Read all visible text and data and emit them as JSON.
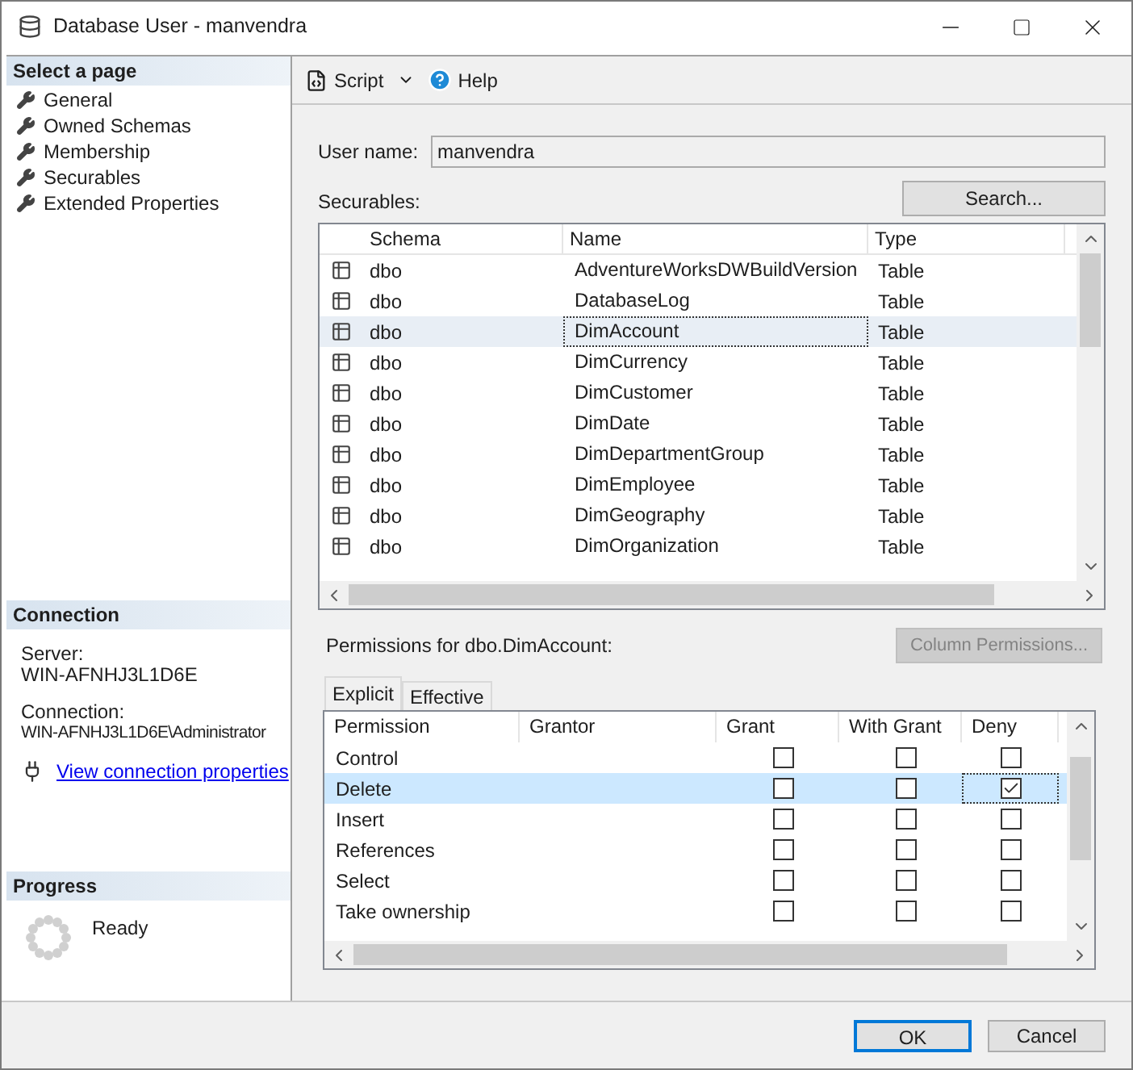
{
  "window": {
    "title": "Database User - manvendra"
  },
  "sidebar": {
    "header": "Select a page",
    "items": [
      {
        "label": "General"
      },
      {
        "label": "Owned Schemas"
      },
      {
        "label": "Membership"
      },
      {
        "label": "Securables"
      },
      {
        "label": "Extended Properties"
      }
    ]
  },
  "connection": {
    "header": "Connection",
    "server_label": "Server:",
    "server": "WIN-AFNHJ3L1D6E",
    "connection_label": "Connection:",
    "connection": "WIN-AFNHJ3L1D6E\\Administrator",
    "link": "View connection properties"
  },
  "progress": {
    "header": "Progress",
    "status": "Ready"
  },
  "toolbar": {
    "script": "Script",
    "help": "Help"
  },
  "user_name": {
    "label": "User name:",
    "value": "manvendra"
  },
  "securables": {
    "label": "Securables:",
    "search": "Search...",
    "columns": [
      "Schema",
      "Name",
      "Type"
    ],
    "rows": [
      {
        "schema": "dbo",
        "name": "AdventureWorksDWBuildVersion",
        "type": "Table",
        "selected": false
      },
      {
        "schema": "dbo",
        "name": "DatabaseLog",
        "type": "Table",
        "selected": false
      },
      {
        "schema": "dbo",
        "name": "DimAccount",
        "type": "Table",
        "selected": true
      },
      {
        "schema": "dbo",
        "name": "DimCurrency",
        "type": "Table",
        "selected": false
      },
      {
        "schema": "dbo",
        "name": "DimCustomer",
        "type": "Table",
        "selected": false
      },
      {
        "schema": "dbo",
        "name": "DimDate",
        "type": "Table",
        "selected": false
      },
      {
        "schema": "dbo",
        "name": "DimDepartmentGroup",
        "type": "Table",
        "selected": false
      },
      {
        "schema": "dbo",
        "name": "DimEmployee",
        "type": "Table",
        "selected": false
      },
      {
        "schema": "dbo",
        "name": "DimGeography",
        "type": "Table",
        "selected": false
      },
      {
        "schema": "dbo",
        "name": "DimOrganization",
        "type": "Table",
        "selected": false
      }
    ]
  },
  "permissions": {
    "label": "Permissions for dbo.DimAccount:",
    "column_permissions": {
      "label": "Column Permissions...",
      "disabled": true
    },
    "tabs": [
      {
        "label": "Explicit",
        "selected": true
      },
      {
        "label": "Effective",
        "selected": false
      }
    ],
    "columns": [
      "Permission",
      "Grantor",
      "Grant",
      "With Grant",
      "Deny"
    ],
    "rows": [
      {
        "permission": "Control",
        "grant": false,
        "with_grant": false,
        "deny": false,
        "selected": false
      },
      {
        "permission": "Delete",
        "grant": false,
        "with_grant": false,
        "deny": true,
        "selected": true
      },
      {
        "permission": "Insert",
        "grant": false,
        "with_grant": false,
        "deny": false,
        "selected": false
      },
      {
        "permission": "References",
        "grant": false,
        "with_grant": false,
        "deny": false,
        "selected": false
      },
      {
        "permission": "Select",
        "grant": false,
        "with_grant": false,
        "deny": false,
        "selected": false
      },
      {
        "permission": "Take ownership",
        "grant": false,
        "with_grant": false,
        "deny": false,
        "selected": false
      }
    ]
  },
  "buttons": [
    {
      "label": "OK",
      "default": true
    },
    {
      "label": "Cancel",
      "default": false
    }
  ]
}
